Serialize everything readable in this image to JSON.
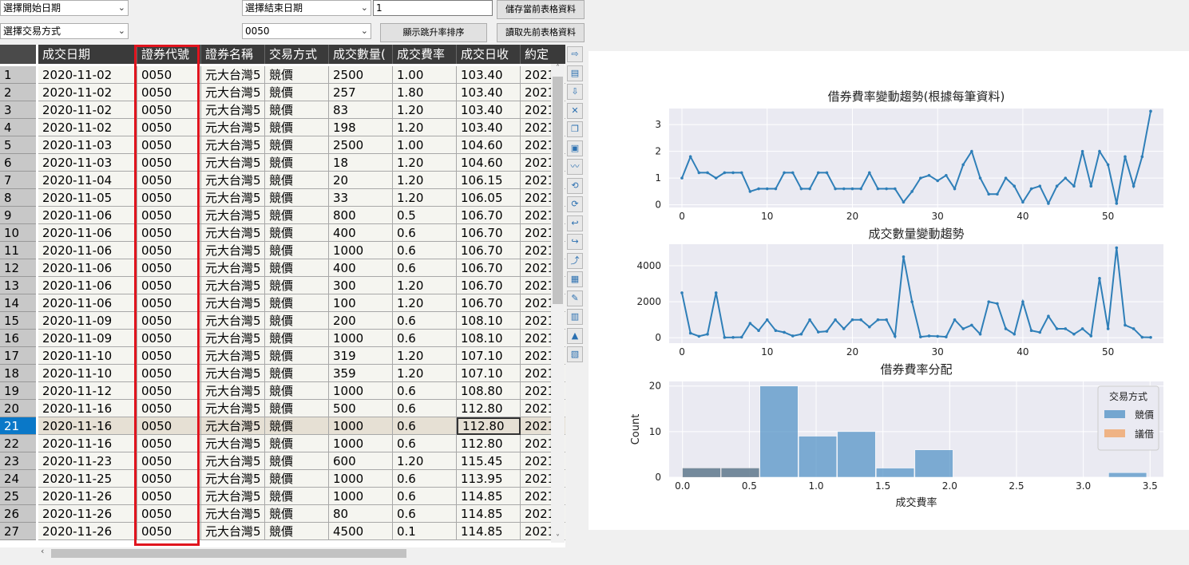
{
  "filters": {
    "start_date": "選擇開始日期",
    "trade_method": "選擇交易方式",
    "end_date": "選擇結束日期",
    "stock_code": "0050",
    "text_value": "1"
  },
  "buttons": {
    "save": "儲存當前表格資料",
    "load": "讀取先前表格資料",
    "sort": "顯示跳升率排序"
  },
  "table": {
    "headers": [
      "成交日期",
      "證券代號",
      "證券名稱",
      "交易方式",
      "成交數量(",
      "成交費率",
      "成交日收",
      "約定"
    ],
    "rows": [
      [
        "1",
        "2020-11-02",
        "0050",
        "元大台灣5",
        "競價",
        "2500",
        "1.00",
        "103.40",
        "2021"
      ],
      [
        "2",
        "2020-11-02",
        "0050",
        "元大台灣5",
        "競價",
        "257",
        "1.80",
        "103.40",
        "2021"
      ],
      [
        "3",
        "2020-11-02",
        "0050",
        "元大台灣5",
        "競價",
        "83",
        "1.20",
        "103.40",
        "2021"
      ],
      [
        "4",
        "2020-11-02",
        "0050",
        "元大台灣5",
        "競價",
        "198",
        "1.20",
        "103.40",
        "2021"
      ],
      [
        "5",
        "2020-11-03",
        "0050",
        "元大台灣5",
        "競價",
        "2500",
        "1.00",
        "104.60",
        "2021"
      ],
      [
        "6",
        "2020-11-03",
        "0050",
        "元大台灣5",
        "競價",
        "18",
        "1.20",
        "104.60",
        "2021"
      ],
      [
        "7",
        "2020-11-04",
        "0050",
        "元大台灣5",
        "競價",
        "20",
        "1.20",
        "106.15",
        "2021"
      ],
      [
        "8",
        "2020-11-05",
        "0050",
        "元大台灣5",
        "競價",
        "33",
        "1.20",
        "106.05",
        "2021"
      ],
      [
        "9",
        "2020-11-06",
        "0050",
        "元大台灣5",
        "競價",
        "800",
        "0.5",
        "106.70",
        "2021"
      ],
      [
        "10",
        "2020-11-06",
        "0050",
        "元大台灣5",
        "競價",
        "400",
        "0.6",
        "106.70",
        "2021"
      ],
      [
        "11",
        "2020-11-06",
        "0050",
        "元大台灣5",
        "競價",
        "1000",
        "0.6",
        "106.70",
        "2021"
      ],
      [
        "12",
        "2020-11-06",
        "0050",
        "元大台灣5",
        "競價",
        "400",
        "0.6",
        "106.70",
        "2021"
      ],
      [
        "13",
        "2020-11-06",
        "0050",
        "元大台灣5",
        "競價",
        "300",
        "1.20",
        "106.70",
        "2021"
      ],
      [
        "14",
        "2020-11-06",
        "0050",
        "元大台灣5",
        "競價",
        "100",
        "1.20",
        "106.70",
        "2021"
      ],
      [
        "15",
        "2020-11-09",
        "0050",
        "元大台灣5",
        "競價",
        "200",
        "0.6",
        "108.10",
        "2021"
      ],
      [
        "16",
        "2020-11-09",
        "0050",
        "元大台灣5",
        "競價",
        "1000",
        "0.6",
        "108.10",
        "2021"
      ],
      [
        "17",
        "2020-11-10",
        "0050",
        "元大台灣5",
        "競價",
        "319",
        "1.20",
        "107.10",
        "2021"
      ],
      [
        "18",
        "2020-11-10",
        "0050",
        "元大台灣5",
        "競價",
        "359",
        "1.20",
        "107.10",
        "2021"
      ],
      [
        "19",
        "2020-11-12",
        "0050",
        "元大台灣5",
        "競價",
        "1000",
        "0.6",
        "108.80",
        "2021"
      ],
      [
        "20",
        "2020-11-16",
        "0050",
        "元大台灣5",
        "競價",
        "500",
        "0.6",
        "112.80",
        "2021"
      ],
      [
        "21",
        "2020-11-16",
        "0050",
        "元大台灣5",
        "競價",
        "1000",
        "0.6",
        "112.80",
        "2021"
      ],
      [
        "22",
        "2020-11-16",
        "0050",
        "元大台灣5",
        "競價",
        "1000",
        "0.6",
        "112.80",
        "2021"
      ],
      [
        "23",
        "2020-11-23",
        "0050",
        "元大台灣5",
        "競價",
        "600",
        "1.20",
        "115.45",
        "2021"
      ],
      [
        "24",
        "2020-11-25",
        "0050",
        "元大台灣5",
        "競價",
        "1000",
        "0.6",
        "113.95",
        "2021"
      ],
      [
        "25",
        "2020-11-26",
        "0050",
        "元大台灣5",
        "競價",
        "1000",
        "0.6",
        "114.85",
        "2021"
      ],
      [
        "26",
        "2020-11-26",
        "0050",
        "元大台灣5",
        "競價",
        "80",
        "0.6",
        "114.85",
        "2021"
      ],
      [
        "27",
        "2020-11-26",
        "0050",
        "元大台灣5",
        "競價",
        "4500",
        "0.1",
        "114.85",
        "2021"
      ]
    ],
    "selected_row": 21
  },
  "toolbar_icons": [
    "export-icon",
    "save-icon",
    "import-icon",
    "excel-icon",
    "copy-icon",
    "paste-icon",
    "chart-icon",
    "undo-icon",
    "redo-icon",
    "back-icon",
    "forward-icon",
    "line-chart-icon",
    "page-icon",
    "edit-icon",
    "calculator-icon",
    "stats-icon",
    "report-icon"
  ],
  "chart_data": [
    {
      "type": "line",
      "title": "借券費率變動趨勢(根據每筆資料)",
      "xlim": [
        -1.5,
        56.5
      ],
      "ylim": [
        -0.1,
        3.6
      ],
      "xticks": [
        0,
        10,
        20,
        30,
        40,
        50
      ],
      "yticks": [
        0,
        1,
        2,
        3
      ],
      "x": [
        0,
        1,
        2,
        3,
        4,
        5,
        6,
        7,
        8,
        9,
        10,
        11,
        12,
        13,
        14,
        15,
        16,
        17,
        18,
        19,
        20,
        21,
        22,
        23,
        24,
        25,
        26,
        27,
        28,
        29,
        30,
        31,
        32,
        33,
        34,
        35,
        36,
        37,
        38,
        39,
        40,
        41,
        42,
        43,
        44,
        45,
        46,
        47,
        48,
        49,
        50,
        51,
        52,
        53,
        54,
        55
      ],
      "values": [
        1.0,
        1.8,
        1.2,
        1.2,
        1.0,
        1.2,
        1.2,
        1.2,
        0.5,
        0.6,
        0.6,
        0.6,
        1.2,
        1.2,
        0.6,
        0.6,
        1.2,
        1.2,
        0.6,
        0.6,
        0.6,
        0.6,
        1.2,
        0.6,
        0.6,
        0.6,
        0.1,
        0.5,
        1.0,
        1.1,
        0.9,
        1.1,
        0.6,
        1.5,
        2.0,
        1.0,
        0.4,
        0.4,
        1.0,
        0.7,
        0.1,
        0.6,
        0.7,
        0.05,
        0.7,
        1.0,
        0.7,
        2.0,
        0.7,
        2.0,
        1.5,
        0.05,
        1.8,
        0.7,
        1.8,
        3.5
      ],
      "grid": true
    },
    {
      "type": "line",
      "title": "成交數量變動趨勢",
      "xlim": [
        -1.5,
        56.5
      ],
      "ylim": [
        -300,
        5200
      ],
      "xticks": [
        0,
        10,
        20,
        30,
        40,
        50
      ],
      "yticks": [
        0,
        2000,
        4000
      ],
      "x": [
        0,
        1,
        2,
        3,
        4,
        5,
        6,
        7,
        8,
        9,
        10,
        11,
        12,
        13,
        14,
        15,
        16,
        17,
        18,
        19,
        20,
        21,
        22,
        23,
        24,
        25,
        26,
        27,
        28,
        29,
        30,
        31,
        32,
        33,
        34,
        35,
        36,
        37,
        38,
        39,
        40,
        41,
        42,
        43,
        44,
        45,
        46,
        47,
        48,
        49,
        50,
        51,
        52,
        53,
        54,
        55
      ],
      "values": [
        2500,
        257,
        83,
        198,
        2500,
        18,
        20,
        33,
        800,
        400,
        1000,
        400,
        300,
        100,
        200,
        1000,
        319,
        359,
        1000,
        500,
        1000,
        1000,
        600,
        1000,
        1000,
        80,
        4500,
        2000,
        50,
        100,
        80,
        50,
        1000,
        500,
        700,
        200,
        2000,
        1900,
        500,
        200,
        2000,
        400,
        300,
        1200,
        500,
        500,
        200,
        500,
        100,
        3300,
        500,
        5000,
        700,
        500,
        30,
        20
      ],
      "grid": true
    },
    {
      "type": "bar",
      "title": "借券費率分配",
      "xlabel": "成交費率",
      "ylabel": "Count",
      "xlim": [
        -0.1,
        3.6
      ],
      "ylim": [
        0,
        21
      ],
      "xticks": [
        0.0,
        0.5,
        1.0,
        1.5,
        2.0,
        2.5,
        3.0,
        3.5
      ],
      "yticks": [
        0,
        10,
        20
      ],
      "legend_title": "交易方式",
      "legend_position": "top-right",
      "bin_edges": [
        0.0,
        0.29,
        0.58,
        0.87,
        1.16,
        1.45,
        1.74,
        2.03,
        2.32,
        2.61,
        2.9,
        3.19,
        3.48
      ],
      "series": [
        {
          "name": "競價",
          "color": "#4c8fc4",
          "values": [
            2,
            2,
            20,
            9,
            10,
            2,
            6,
            0,
            0,
            0,
            0,
            1
          ]
        },
        {
          "name": "議借",
          "color": "#f0a060",
          "values": [
            2,
            2,
            0,
            0,
            0,
            0,
            0,
            0,
            0,
            0,
            0,
            0
          ]
        }
      ],
      "grid": true
    }
  ]
}
